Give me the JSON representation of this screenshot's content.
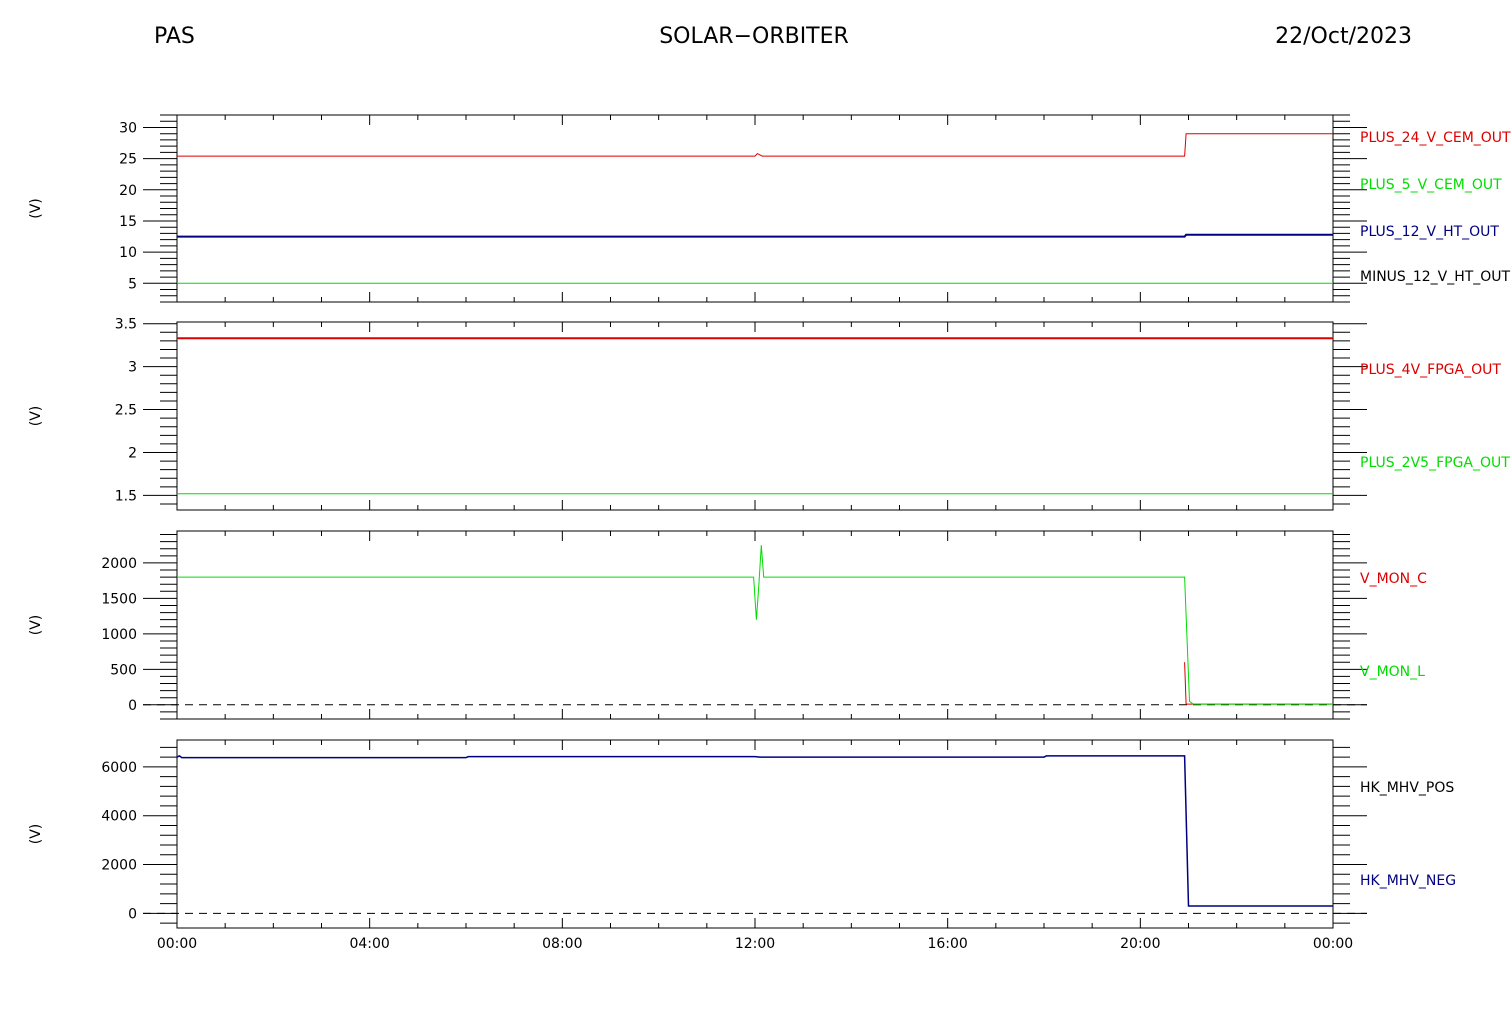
{
  "header": {
    "left": "PAS",
    "center": "SOLAR−ORBITER",
    "right": "22/Oct/2023"
  },
  "chart_data": [
    {
      "type": "line",
      "ylabel": "(V)",
      "ylim": [
        2.0,
        32.0
      ],
      "yticks": [
        5,
        10,
        15,
        20,
        25,
        30
      ],
      "xticks": [
        "00:00",
        "04:00",
        "08:00",
        "12:00",
        "16:00",
        "20:00",
        "00:00"
      ],
      "xlim_hours": [
        0,
        24
      ],
      "series": [
        {
          "name": "PLUS_24_V_CEM_OUT",
          "color": "#dd0000",
          "width": 1,
          "points": [
            [
              0,
              25.4
            ],
            [
              12.0,
              25.4
            ],
            [
              12.05,
              25.8
            ],
            [
              12.15,
              25.4
            ],
            [
              20.92,
              25.4
            ],
            [
              20.95,
              29.0
            ],
            [
              24,
              29.0
            ]
          ]
        },
        {
          "name": "PLUS_5_V_CEM_OUT",
          "color": "#00dd00",
          "width": 1,
          "points": [
            [
              0,
              5.0
            ],
            [
              24,
              5.0
            ]
          ]
        },
        {
          "name": "PLUS_12_V_HT_OUT",
          "color": "#000080",
          "width": 2,
          "points": [
            [
              0,
              12.5
            ],
            [
              20.92,
              12.5
            ],
            [
              20.95,
              12.8
            ],
            [
              24,
              12.8
            ]
          ]
        },
        {
          "name": "MINUS_12_V_HT_OUT",
          "color": "#000000",
          "width": 1,
          "points": []
        }
      ]
    },
    {
      "type": "line",
      "ylabel": "(V)",
      "ylim": [
        1.33,
        3.52
      ],
      "yticks": [
        1.5,
        2.0,
        2.5,
        3.0,
        3.5
      ],
      "xticks": [
        "00:00",
        "04:00",
        "08:00",
        "12:00",
        "16:00",
        "20:00",
        "00:00"
      ],
      "xlim_hours": [
        0,
        24
      ],
      "series": [
        {
          "name": "PLUS_4V_FPGA_OUT",
          "color": "#dd0000",
          "width": 2,
          "points": [
            [
              0,
              3.33
            ],
            [
              20.92,
              3.33
            ],
            [
              20.95,
              3.33
            ],
            [
              24,
              3.33
            ]
          ]
        },
        {
          "name": "PLUS_2V5_FPGA_OUT",
          "color": "#00dd00",
          "width": 1,
          "points": [
            [
              0,
              1.52
            ],
            [
              24,
              1.52
            ]
          ]
        }
      ]
    },
    {
      "type": "line",
      "ylabel": "(V)",
      "ylim": [
        -200,
        2450
      ],
      "yticks": [
        0,
        500,
        1000,
        1500,
        2000
      ],
      "xticks": [
        "00:00",
        "04:00",
        "08:00",
        "12:00",
        "16:00",
        "20:00",
        "00:00"
      ],
      "xlim_hours": [
        0,
        24
      ],
      "zero_line": true,
      "series": [
        {
          "name": "V_MON_C",
          "color": "#dd0000",
          "width": 1,
          "points": [
            [
              20.92,
              600
            ],
            [
              20.95,
              10
            ],
            [
              24,
              10
            ]
          ]
        },
        {
          "name": "V_MON_L",
          "color": "#00dd00",
          "width": 1,
          "points": [
            [
              0,
              1800
            ],
            [
              11.97,
              1800
            ],
            [
              12.03,
              1200
            ],
            [
              12.08,
              1700
            ],
            [
              12.13,
              2250
            ],
            [
              12.18,
              1800
            ],
            [
              20.92,
              1800
            ],
            [
              21.02,
              50
            ],
            [
              21.1,
              10
            ],
            [
              24,
              10
            ]
          ]
        }
      ]
    },
    {
      "type": "line",
      "ylabel": "(V)",
      "ylim": [
        -600,
        7100
      ],
      "yticks": [
        0,
        2000,
        4000,
        6000
      ],
      "xticks": [
        "00:00",
        "04:00",
        "08:00",
        "12:00",
        "16:00",
        "20:00",
        "00:00"
      ],
      "xlim_hours": [
        0,
        24
      ],
      "zero_line": true,
      "series": [
        {
          "name": "HK_MHV_POS",
          "color": "#000000",
          "width": 1,
          "points": []
        },
        {
          "name": "HK_MHV_NEG",
          "color": "#000080",
          "width": 1.5,
          "points": [
            [
              0,
              6400
            ],
            [
              0.05,
              6450
            ],
            [
              0.1,
              6380
            ],
            [
              6.0,
              6380
            ],
            [
              6.05,
              6420
            ],
            [
              12.0,
              6420
            ],
            [
              12.1,
              6400
            ],
            [
              18.0,
              6400
            ],
            [
              18.05,
              6450
            ],
            [
              20.92,
              6450
            ],
            [
              21.0,
              300
            ],
            [
              24,
              300
            ]
          ]
        }
      ]
    }
  ]
}
